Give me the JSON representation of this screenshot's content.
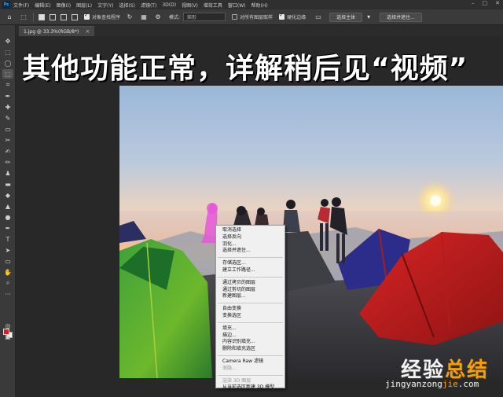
{
  "menubar": {
    "logo": "Ps",
    "items": [
      "文件(F)",
      "编辑(E)",
      "图像(I)",
      "图层(L)",
      "文字(Y)",
      "选择(S)",
      "滤镜(T)",
      "3D(D)",
      "视图(V)",
      "增效工具",
      "窗口(W)",
      "帮助(H)"
    ]
  },
  "options": {
    "remove_hair_label": "对象查找程序",
    "mode_label": "模式:",
    "mode_value": "矩形",
    "sample_all_label": "对所有图层取样",
    "enhance_edge_label": "硬化边缘",
    "select_subject_label": "选择主体",
    "select_mask_label": "选择并遮住..."
  },
  "document": {
    "tab_title": "1.jpg @ 33.3%(RGB/8*)",
    "tab_close": "×"
  },
  "caption": "其他功能正常，详解稍后见“视频”",
  "context_menu": {
    "groups": [
      [
        "取消选择",
        "选择反向",
        "羽化...",
        "选择并遮住..."
      ],
      [
        "存储选区...",
        "建立工作路径..."
      ],
      [
        "通过拷贝的图层",
        "通过剪切的图层",
        "新建图层..."
      ],
      [
        "自由变换",
        "变换选区"
      ],
      [
        "填充...",
        "描边...",
        "内容识别填充...",
        "删除和填充选区"
      ],
      [
        "Camera Raw 滤镜",
        "渐隐..."
      ],
      [
        "渲染 3D 图层",
        "从当前选区新建 3D 模型"
      ]
    ],
    "disabled": [
      "渐隐...",
      "渲染 3D 图层"
    ]
  },
  "watermark": {
    "title_a": "经验",
    "title_b": "总结",
    "url_a": "jingyanzong",
    "url_b": "jie",
    "url_c": ".com"
  },
  "colors": {
    "foreground": "#e21b1b",
    "background": "#ffffff",
    "accent": "#f5a000"
  },
  "tools": [
    "move-icon",
    "marquee-icon",
    "lasso-icon",
    "object-select-icon",
    "crop-icon",
    "eyedropper-icon",
    "healing-icon",
    "brush-icon",
    "stamp-icon",
    "history-brush-icon",
    "eraser-icon",
    "gradient-icon",
    "blur-icon",
    "dodge-icon",
    "pen-icon",
    "type-icon",
    "path-select-icon",
    "shape-icon",
    "hand-icon",
    "zoom-icon",
    "more-icon"
  ]
}
